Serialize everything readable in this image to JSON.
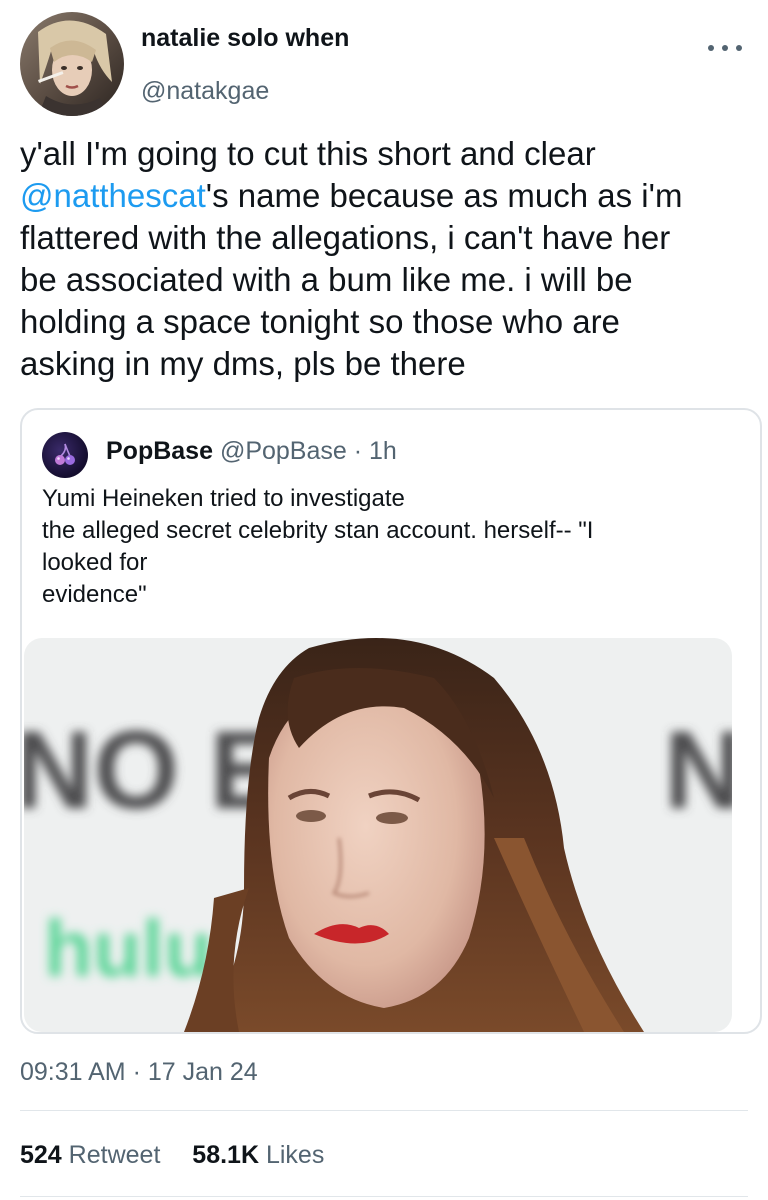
{
  "tweet": {
    "author": {
      "display_name": "natalie solo when",
      "handle": "@natakgae"
    },
    "text": {
      "line1": "y'all I'm going to cut this short and clear",
      "mention": "@natthescat",
      "line2_rest": "'s name because as much as i'm",
      "line3": "flattered with the allegations, i can't have her",
      "line4": "be associated with a bum like me. i will be",
      "line5": "holding a space tonight so those who are",
      "line6": "asking in my dms, pls be there"
    },
    "quoted": {
      "display_name": "PopBase",
      "handle": "@PopBase",
      "separator": "·",
      "time": "1h",
      "text_lines": [
        "Yumi Heineken tried to investigate",
        "the alleged secret celebrity stan account. herself-- \"I",
        "looked for",
        "evidence\""
      ],
      "image_backdrop_text": "NO EX",
      "image_backdrop_text_right": "N",
      "image_backdrop_logo": "hulu"
    },
    "timestamp": {
      "time": "09:31 AM",
      "separator": "·",
      "date": "17 Jan 24"
    },
    "stats": {
      "retweets_count": "524",
      "retweets_label": "Retweet",
      "likes_count": "58.1K",
      "likes_label": "Likes"
    }
  },
  "colors": {
    "link": "#1d9bf0",
    "secondary_text": "#536471",
    "primary_text": "#0f1419",
    "border": "#dfe3e7"
  },
  "icons": {
    "more": "more-horizontal-icon",
    "quoted_avatar": "popbase-cherry-logo"
  }
}
